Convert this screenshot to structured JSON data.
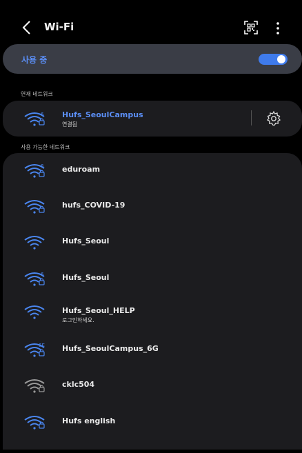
{
  "header": {
    "title": "Wi-Fi"
  },
  "toggle": {
    "label": "사용 중",
    "on": true
  },
  "sections": {
    "current": "연재 네트워크",
    "available": "사용 가능한 네트워크"
  },
  "current_network": {
    "name": "Hufs_SeoulCampus",
    "status": "연결됨",
    "lock_badge": ""
  },
  "networks": [
    {
      "name": "eduroam",
      "sub": "",
      "badge": "6",
      "lock": true
    },
    {
      "name": "hufs_COVID-19",
      "sub": "",
      "badge": "",
      "lock": true
    },
    {
      "name": "Hufs_Seoul",
      "sub": "",
      "badge": "",
      "lock": false
    },
    {
      "name": "Hufs_Seoul",
      "sub": "",
      "badge": "6",
      "lock": true
    },
    {
      "name": "Hufs_Seoul_HELP",
      "sub": "로그인하세요.",
      "badge": "",
      "lock": false
    },
    {
      "name": "Hufs_SeoulCampus_6G",
      "sub": "",
      "badge": "6E",
      "lock": true
    },
    {
      "name": "cklc504",
      "sub": "",
      "badge": "",
      "lock": true
    },
    {
      "name": "Hufs english",
      "sub": "",
      "badge": "",
      "lock": true
    }
  ],
  "colors": {
    "accent": "#3f7bec",
    "wifi_blue": "#4a86f0",
    "wifi_gray": "#9a9a9a"
  },
  "icons": {
    "back": "chevron-left-icon",
    "qr": "qr-code-icon",
    "more": "more-vertical-icon",
    "wifi": "wifi-icon",
    "gear": "gear-icon"
  }
}
